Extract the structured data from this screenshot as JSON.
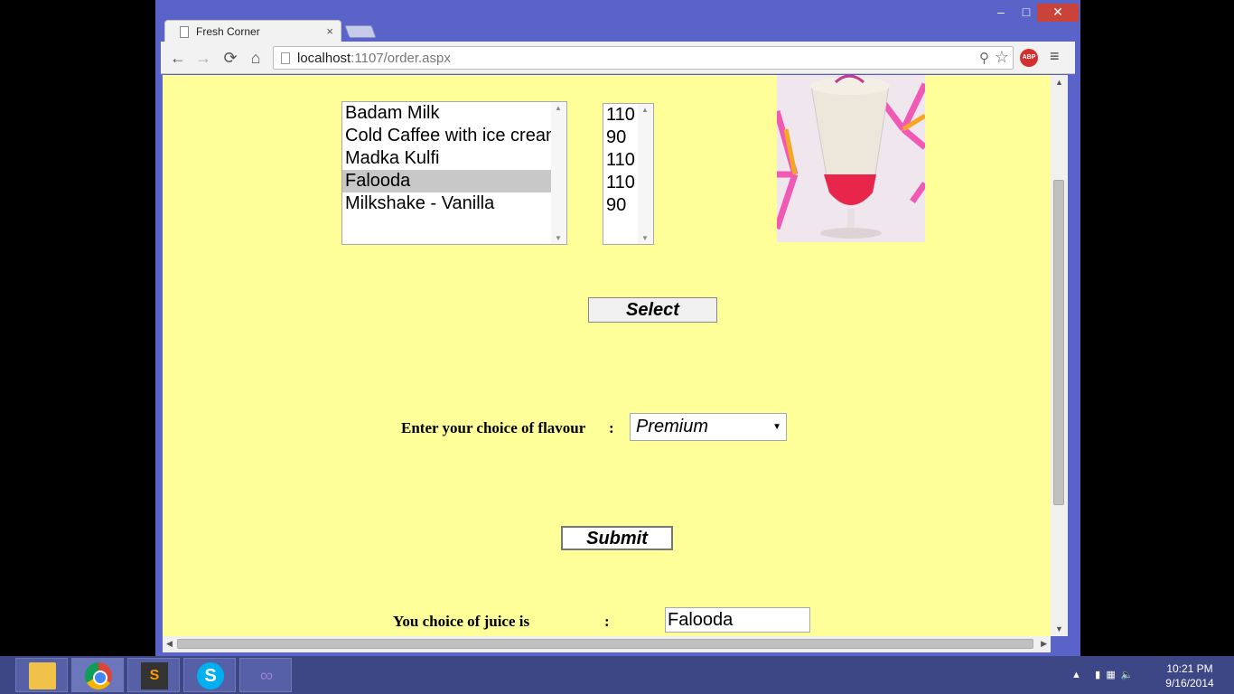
{
  "browser": {
    "tab_title": "Fresh Corner",
    "tab_close": "×",
    "url_host": "localhost",
    "url_path": ":1107/order.aspx",
    "window_controls": {
      "minimize": "–",
      "maximize": "□",
      "close": "✕"
    },
    "icons": {
      "back": "←",
      "forward": "→",
      "reload": "⟳",
      "home": "⌂",
      "zoom": "⚲",
      "star": "☆",
      "abp": "ABP",
      "menu": "≡"
    }
  },
  "form": {
    "items": [
      {
        "label": "Badam Milk",
        "selected": false
      },
      {
        "label": "Cold Caffee with ice cream",
        "selected": false
      },
      {
        "label": "Madka Kulfi",
        "selected": false
      },
      {
        "label": "Falooda",
        "selected": true
      },
      {
        "label": "Milkshake - Vanilla",
        "selected": false
      }
    ],
    "prices": [
      "110",
      "90",
      "110",
      "110",
      "90"
    ],
    "select_button": "Select",
    "flavour_label": "Enter your choice of flavour",
    "colon": ":",
    "flavour_value": "Premium",
    "submit_button": "Submit",
    "result_label": "You choice of juice is",
    "result_value": "Falooda"
  },
  "taskbar": {
    "apps": [
      "file-explorer",
      "google-chrome",
      "sublime-text",
      "skype",
      "visual-studio"
    ],
    "time": "10:21 PM",
    "date": "9/16/2014"
  }
}
